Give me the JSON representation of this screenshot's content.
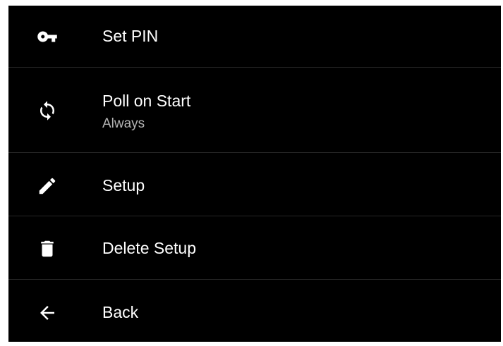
{
  "menu": {
    "items": [
      {
        "icon": "key-icon",
        "label": "Set PIN"
      },
      {
        "icon": "sync-icon",
        "label": "Poll on Start",
        "value": "Always"
      },
      {
        "icon": "pencil-icon",
        "label": "Setup"
      },
      {
        "icon": "trash-icon",
        "label": "Delete Setup"
      },
      {
        "icon": "arrow-back-icon",
        "label": "Back"
      }
    ]
  }
}
